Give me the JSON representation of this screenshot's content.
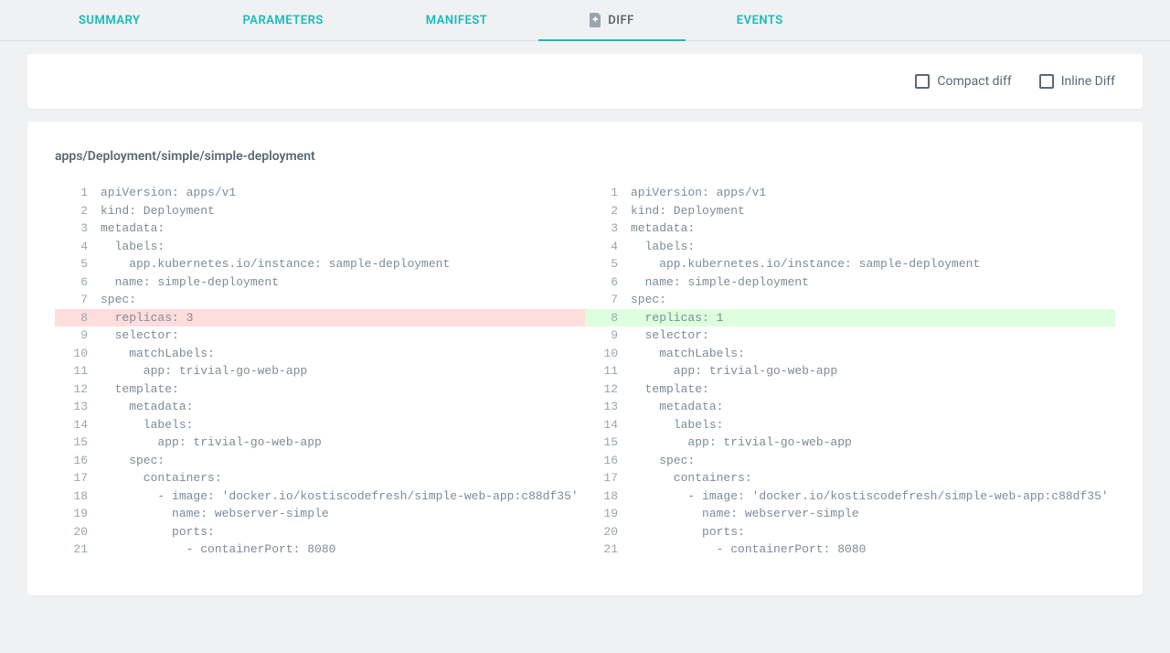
{
  "tabs": [
    {
      "label": "SUMMARY"
    },
    {
      "label": "PARAMETERS"
    },
    {
      "label": "MANIFEST"
    },
    {
      "label": "DIFF",
      "active": true,
      "iconColor": "#9aa5b0"
    },
    {
      "label": "EVENTS"
    }
  ],
  "options": {
    "compact": "Compact diff",
    "inline": "Inline Diff"
  },
  "diff": {
    "title": "apps/Deployment/simple/simple-deployment",
    "left": [
      {
        "n": 1,
        "t": "apiVersion: apps/v1"
      },
      {
        "n": 2,
        "t": "kind: Deployment"
      },
      {
        "n": 3,
        "t": "metadata:"
      },
      {
        "n": 4,
        "t": "  labels:"
      },
      {
        "n": 5,
        "t": "    app.kubernetes.io/instance: sample-deployment"
      },
      {
        "n": 6,
        "t": "  name: simple-deployment"
      },
      {
        "n": 7,
        "t": "spec:"
      },
      {
        "n": 8,
        "t": "  replicas: 3",
        "mark": "removed"
      },
      {
        "n": 9,
        "t": "  selector:"
      },
      {
        "n": 10,
        "t": "    matchLabels:"
      },
      {
        "n": 11,
        "t": "      app: trivial-go-web-app"
      },
      {
        "n": 12,
        "t": "  template:"
      },
      {
        "n": 13,
        "t": "    metadata:"
      },
      {
        "n": 14,
        "t": "      labels:"
      },
      {
        "n": 15,
        "t": "        app: trivial-go-web-app"
      },
      {
        "n": 16,
        "t": "    spec:"
      },
      {
        "n": 17,
        "t": "      containers:"
      },
      {
        "n": 18,
        "t": "        - image: 'docker.io/kostiscodefresh/simple-web-app:c88df35'"
      },
      {
        "n": 19,
        "t": "          name: webserver-simple"
      },
      {
        "n": 20,
        "t": "          ports:"
      },
      {
        "n": 21,
        "t": "            - containerPort: 8080"
      }
    ],
    "right": [
      {
        "n": 1,
        "t": "apiVersion: apps/v1"
      },
      {
        "n": 2,
        "t": "kind: Deployment"
      },
      {
        "n": 3,
        "t": "metadata:"
      },
      {
        "n": 4,
        "t": "  labels:"
      },
      {
        "n": 5,
        "t": "    app.kubernetes.io/instance: sample-deployment"
      },
      {
        "n": 6,
        "t": "  name: simple-deployment"
      },
      {
        "n": 7,
        "t": "spec:"
      },
      {
        "n": 8,
        "t": "  replicas: 1",
        "mark": "added"
      },
      {
        "n": 9,
        "t": "  selector:"
      },
      {
        "n": 10,
        "t": "    matchLabels:"
      },
      {
        "n": 11,
        "t": "      app: trivial-go-web-app"
      },
      {
        "n": 12,
        "t": "  template:"
      },
      {
        "n": 13,
        "t": "    metadata:"
      },
      {
        "n": 14,
        "t": "      labels:"
      },
      {
        "n": 15,
        "t": "        app: trivial-go-web-app"
      },
      {
        "n": 16,
        "t": "    spec:"
      },
      {
        "n": 17,
        "t": "      containers:"
      },
      {
        "n": 18,
        "t": "        - image: 'docker.io/kostiscodefresh/simple-web-app:c88df35'"
      },
      {
        "n": 19,
        "t": "          name: webserver-simple"
      },
      {
        "n": 20,
        "t": "          ports:"
      },
      {
        "n": 21,
        "t": "            - containerPort: 8080"
      }
    ]
  }
}
